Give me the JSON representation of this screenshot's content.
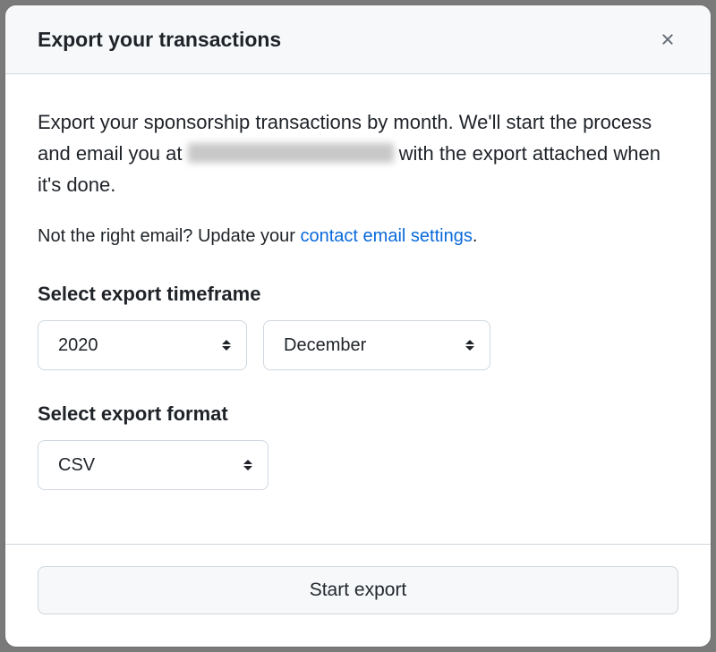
{
  "modal": {
    "title": "Export your transactions",
    "description_prefix": "Export your sponsorship transactions by month. We'll start the process and email you at ",
    "description_suffix": " with the export attached when it's done.",
    "email_note_prefix": "Not the right email? Update your ",
    "email_link_text": "contact email settings",
    "email_note_suffix": "."
  },
  "timeframe": {
    "label": "Select export timeframe",
    "year_selected": "2020",
    "month_selected": "December"
  },
  "format": {
    "label": "Select export format",
    "selected": "CSV"
  },
  "footer": {
    "start_label": "Start export"
  }
}
